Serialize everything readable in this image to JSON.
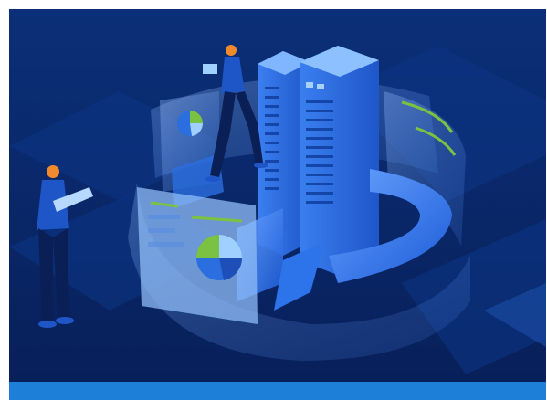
{
  "hero": {
    "icon": "server-datacenter-illustration",
    "colors": {
      "background": "#0a2a6b",
      "server": "#2f6fe0",
      "glass_ring": "#7fb3f5",
      "person_head": "#f08a2c",
      "chart_green": "#7cc242"
    }
  },
  "footer": {
    "color": "#1e7fd8"
  }
}
